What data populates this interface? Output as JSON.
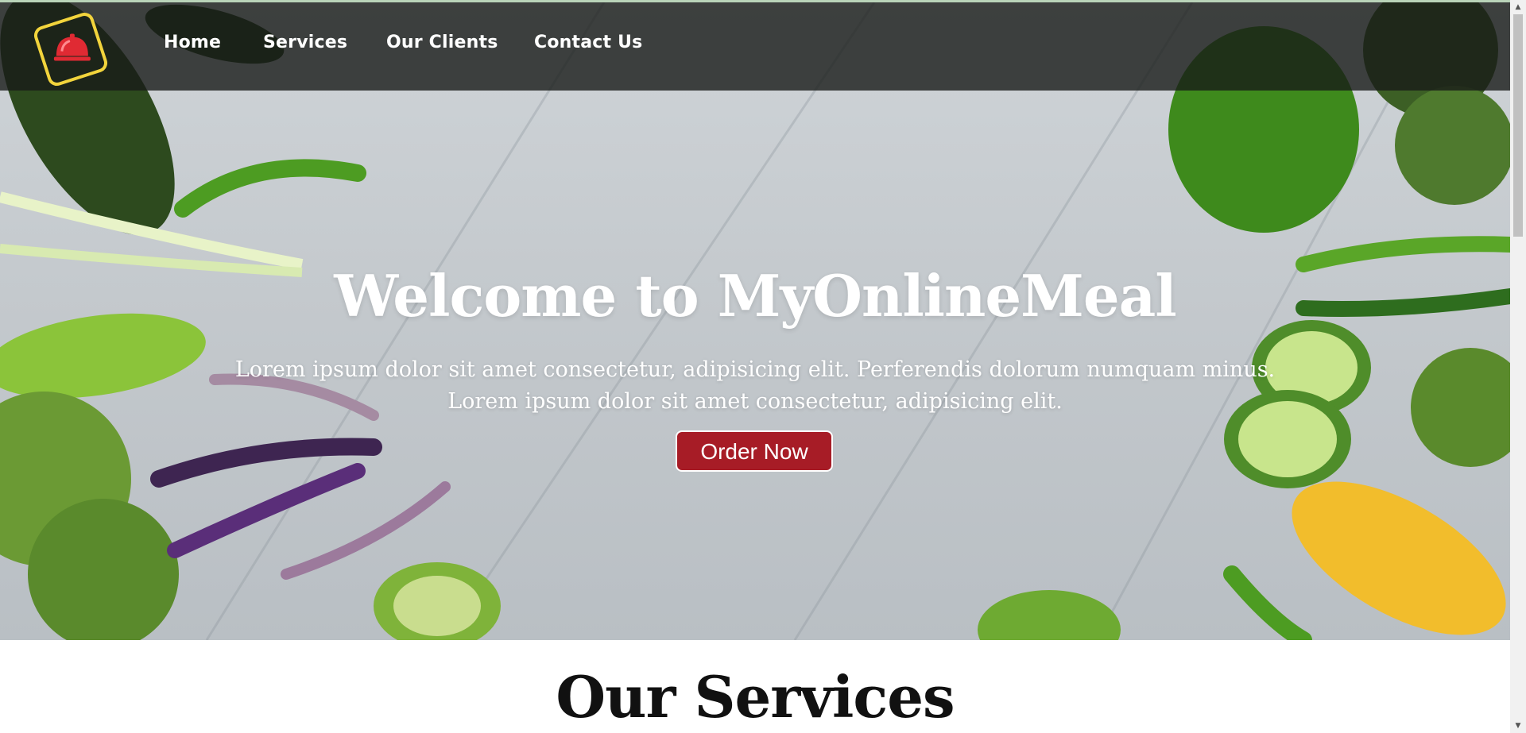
{
  "nav": {
    "logo_icon": "cloche-icon",
    "links": [
      "Home",
      "Services",
      "Our Clients",
      "Contact Us"
    ]
  },
  "hero": {
    "title": "Welcome to MyOnlineMeal",
    "line1": "Lorem ipsum dolor sit amet consectetur, adipisicing elit. Perferendis dolorum numquam minus.",
    "line2": "Lorem ipsum dolor sit amet consectetur, adipisicing elit.",
    "cta_label": "Order Now"
  },
  "services": {
    "title": "Our Services"
  },
  "colors": {
    "accent": "#a71c26",
    "logo_border": "#f2d43c",
    "nav_bg": "#1a1c1a"
  }
}
